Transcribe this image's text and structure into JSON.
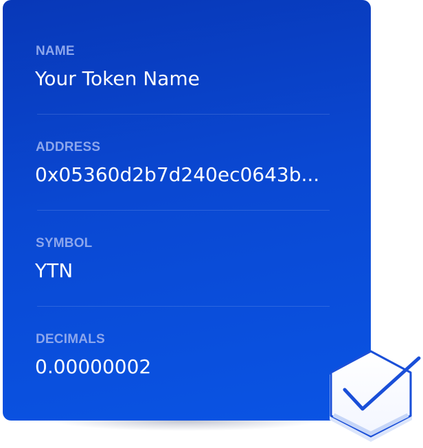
{
  "token": {
    "fields": [
      {
        "label": "NAME",
        "value": "Your Token Name"
      },
      {
        "label": "ADDRESS",
        "value": "0x05360d2b7d240ec0643b..."
      },
      {
        "label": "SYMBOL",
        "value": "YTN"
      },
      {
        "label": "DECIMALS",
        "value": "0.00000002"
      }
    ]
  },
  "colors": {
    "card_top": "#0838b8",
    "card_bottom": "#0a54e4",
    "label": "#8ca6ec",
    "value": "#ffffff",
    "badge_stroke": "#1a4fd8"
  },
  "icons": {
    "badge": "verified-check-icon"
  }
}
